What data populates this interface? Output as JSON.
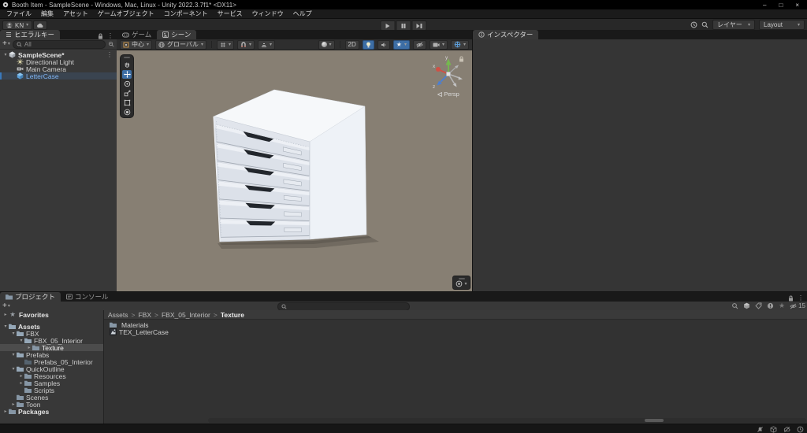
{
  "window": {
    "title": "Booth Item - SampleScene - Windows, Mac, Linux - Unity 2022.3.7f1* <DX11>",
    "controls": {
      "minimize": "–",
      "maximize": "□",
      "close": "×"
    }
  },
  "menubar": {
    "items": [
      "ファイル",
      "編集",
      "アセット",
      "ゲームオブジェクト",
      "コンポーネント",
      "サービス",
      "ウィンドウ",
      "ヘルプ"
    ]
  },
  "toolbar": {
    "account": "KN",
    "layers": "レイヤー",
    "layout": "Layout"
  },
  "hierarchy": {
    "tab": "ヒエラルキー",
    "add_button": "+",
    "search_filter": "All",
    "rows": [
      {
        "label": "SampleScene*"
      },
      {
        "label": "Directional Light"
      },
      {
        "label": "Main Camera"
      },
      {
        "label": "LetterCase"
      }
    ]
  },
  "scene_view": {
    "tabs": {
      "game": "ゲーム",
      "scene": "シーン"
    },
    "toolbar": {
      "pivot": "中心",
      "orientation": "グローバル",
      "mode_2d": "2D"
    },
    "gizmo": {
      "x": "x",
      "y": "y",
      "z": "z",
      "projection": "Persp"
    }
  },
  "inspector": {
    "tab": "インスペクター"
  },
  "project": {
    "tab": "プロジェクト",
    "console_tab": "コンソール",
    "add_button": "+",
    "hidden_count": "15",
    "tree": [
      {
        "label": "Favorites",
        "depth": 0,
        "arrow": "▸",
        "icon": "star",
        "bold": true
      },
      {
        "label": "Assets",
        "depth": 0,
        "arrow": "▾",
        "icon": "folder-open",
        "bold": true
      },
      {
        "label": "FBX",
        "depth": 1,
        "arrow": "▾",
        "icon": "folder-open"
      },
      {
        "label": "FBX_05_Interior",
        "depth": 2,
        "arrow": "▾",
        "icon": "folder-open"
      },
      {
        "label": "Texture",
        "depth": 3,
        "arrow": "▸",
        "icon": "folder",
        "selected": true
      },
      {
        "label": "Prefabs",
        "depth": 1,
        "arrow": "▾",
        "icon": "folder-open"
      },
      {
        "label": "Prefabs_05_Interior",
        "depth": 2,
        "arrow": "",
        "icon": "folder-empty"
      },
      {
        "label": "QuickOutline",
        "depth": 1,
        "arrow": "▾",
        "icon": "folder-open"
      },
      {
        "label": "Resources",
        "depth": 2,
        "arrow": "▸",
        "icon": "folder"
      },
      {
        "label": "Samples",
        "depth": 2,
        "arrow": "▸",
        "icon": "folder"
      },
      {
        "label": "Scripts",
        "depth": 2,
        "arrow": "",
        "icon": "folder"
      },
      {
        "label": "Scenes",
        "depth": 1,
        "arrow": "",
        "icon": "folder"
      },
      {
        "label": "Toon",
        "depth": 1,
        "arrow": "▸",
        "icon": "folder"
      },
      {
        "label": "Packages",
        "depth": 0,
        "arrow": "▸",
        "icon": "folder",
        "bold": true
      }
    ],
    "breadcrumb": [
      "Assets",
      "FBX",
      "FBX_05_Interior",
      "Texture"
    ],
    "content": [
      {
        "label": "Materials"
      },
      {
        "label": "TEX_LetterCase"
      }
    ]
  },
  "colors": {
    "accent_blue": "#3a79bb",
    "selection_text": "#7fb3f1",
    "viewport_background": "#877f73"
  }
}
